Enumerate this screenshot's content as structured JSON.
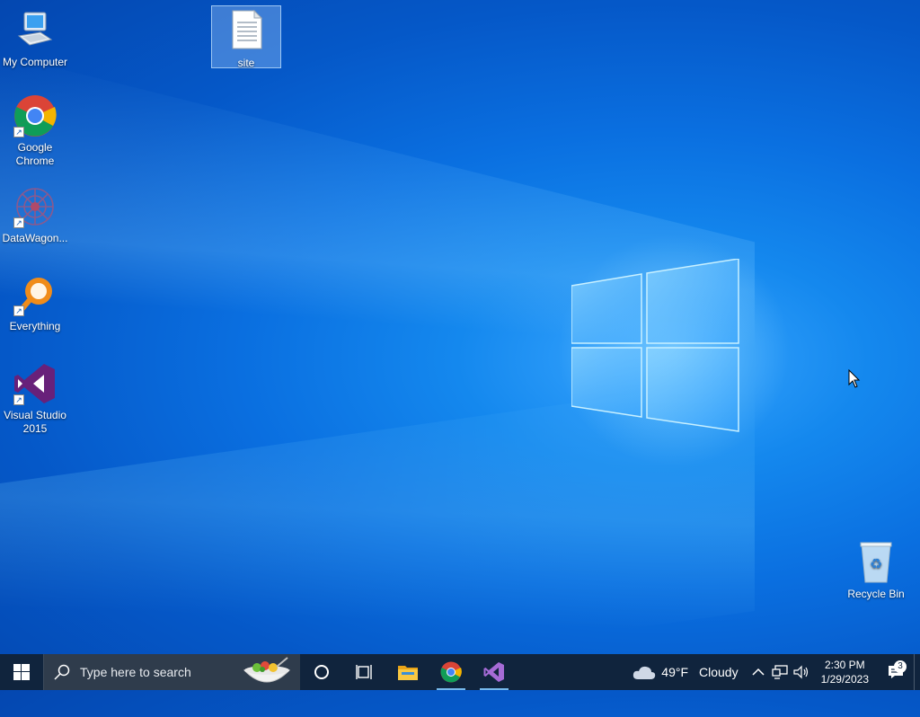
{
  "desktop": {
    "icons": [
      {
        "label": "My Computer",
        "icon": "computer-icon"
      },
      {
        "label": "site",
        "icon": "text-file-icon"
      },
      {
        "label": "Google\nChrome",
        "icon": "chrome-icon"
      },
      {
        "label": "DataWagon...",
        "icon": "datawagon-icon"
      },
      {
        "label": "Everything",
        "icon": "everything-search-icon"
      },
      {
        "label": "Visual Studio\n2015",
        "icon": "visual-studio-icon"
      },
      {
        "label": "Recycle Bin",
        "icon": "recycle-bin-icon"
      }
    ]
  },
  "taskbar": {
    "search_placeholder": "Type here to search",
    "apps": [
      {
        "name": "Cortana",
        "icon": "cortana-circle-icon"
      },
      {
        "name": "Task View",
        "icon": "task-view-icon"
      },
      {
        "name": "File Explorer",
        "icon": "folder-icon"
      },
      {
        "name": "Google Chrome",
        "icon": "chrome-icon"
      },
      {
        "name": "Visual Studio",
        "icon": "visual-studio-icon"
      }
    ],
    "weather": {
      "temp": "49°F",
      "condition": "Cloudy",
      "icon": "cloud-icon"
    },
    "clock": {
      "time": "2:30 PM",
      "date": "1/29/2023"
    },
    "notifications_count": "3"
  },
  "colors": {
    "taskbar_bg": "#10243d",
    "search_bg": "#2f3c4c",
    "desktop_accent": "#0a6fe0",
    "vs_purple": "#68217a"
  }
}
